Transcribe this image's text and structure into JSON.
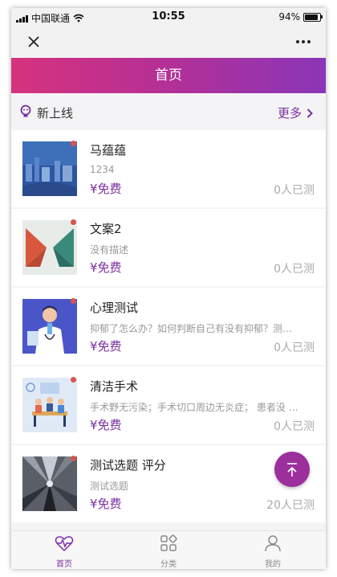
{
  "status_bar": {
    "carrier": "中国联通",
    "time": "10:55",
    "battery": "94%"
  },
  "header": {
    "title": "首页"
  },
  "section": {
    "title": "新上线",
    "more_label": "更多"
  },
  "items": [
    {
      "name": "马蕴蕴",
      "desc": "1234",
      "price": "¥免费",
      "count": "0人已测"
    },
    {
      "name": "文案2",
      "desc": "没有描述",
      "price": "¥免费",
      "count": "0人已测"
    },
    {
      "name": "心理测试",
      "desc": "抑郁了怎么办？如何判断自己有没有抑郁？测…",
      "price": "¥免费",
      "count": "0人已测"
    },
    {
      "name": "清洁手术",
      "desc": "手术野无污染；手术切口周边无炎症； 患者没 …",
      "price": "¥免费",
      "count": "0人已测"
    },
    {
      "name": "测试选题 评分",
      "desc": "测试选题",
      "price": "¥免费",
      "count": "20人已测"
    }
  ],
  "tabs": [
    {
      "label": "首页",
      "icon": "heartbeat-icon",
      "active": true
    },
    {
      "label": "分类",
      "icon": "category-icon",
      "active": false
    },
    {
      "label": "我的",
      "icon": "user-icon",
      "active": false
    }
  ],
  "colors": {
    "accent": "#7b2fa0",
    "header_start": "#d6337d",
    "header_end": "#8a36b8",
    "fab": "#9b2f9c"
  }
}
